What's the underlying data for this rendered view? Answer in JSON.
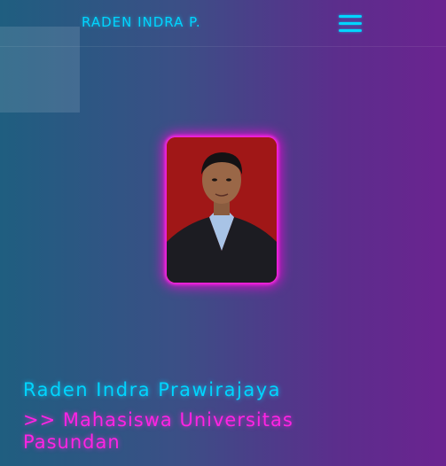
{
  "header": {
    "brand": "RADEN INDRA P.",
    "menu_icon": "hamburger-menu-icon"
  },
  "profile": {
    "photo_alt": "Raden Indra Prawirajaya",
    "name": "Raden Indra Prawirajaya",
    "subtitle": ">> Mahasiswa Universitas Pasundan"
  },
  "colors": {
    "accent_cyan": "#00d5ff",
    "accent_magenta": "#ff23e3",
    "bg_start": "#1f5e80",
    "bg_end": "#6b2390"
  }
}
